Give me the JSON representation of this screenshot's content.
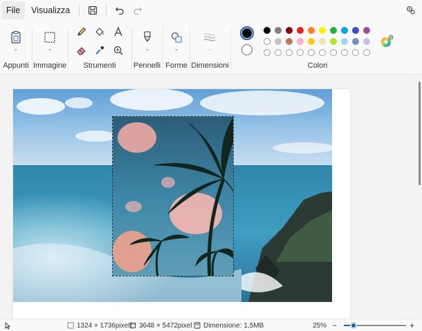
{
  "menu": {
    "file": "File",
    "view": "Visualizza"
  },
  "quick_access": {
    "save_icon": "save-icon",
    "undo_icon": "undo-icon",
    "redo_icon": "redo-icon",
    "settings_icon": "settings-icon"
  },
  "ribbon": {
    "clipboard_label": "Appunti",
    "image_label": "Immagine",
    "tools_label": "Strumenti",
    "brushes_label": "Pennelli",
    "shapes_label": "Forme",
    "size_label": "Dimensioni",
    "colors_label": "Colori"
  },
  "colors": {
    "primary": "#000000",
    "secondary": "#ffffff",
    "palette_row1": [
      "#000000",
      "#7f7f7f",
      "#880015",
      "#ed1c24",
      "#ff7f27",
      "#fff200",
      "#22b14c",
      "#00a2e8",
      "#3f48cc",
      "#a349a4"
    ],
    "palette_row2": [
      "#ffffff",
      "#c3c3c3",
      "#b97a57",
      "#ffaec9",
      "#ffc90e",
      "#efe4b0",
      "#b5e61d",
      "#99d9ea",
      "#7092be",
      "#c8bfe7"
    ],
    "palette_row3_empty_count": 10
  },
  "status": {
    "selection_size": "1324 × 1736pixel",
    "image_size": "3648 × 5472pixel",
    "file_size": "Dimensione: 1,5MB",
    "zoom": "25%",
    "zoom_level": 0.1
  }
}
